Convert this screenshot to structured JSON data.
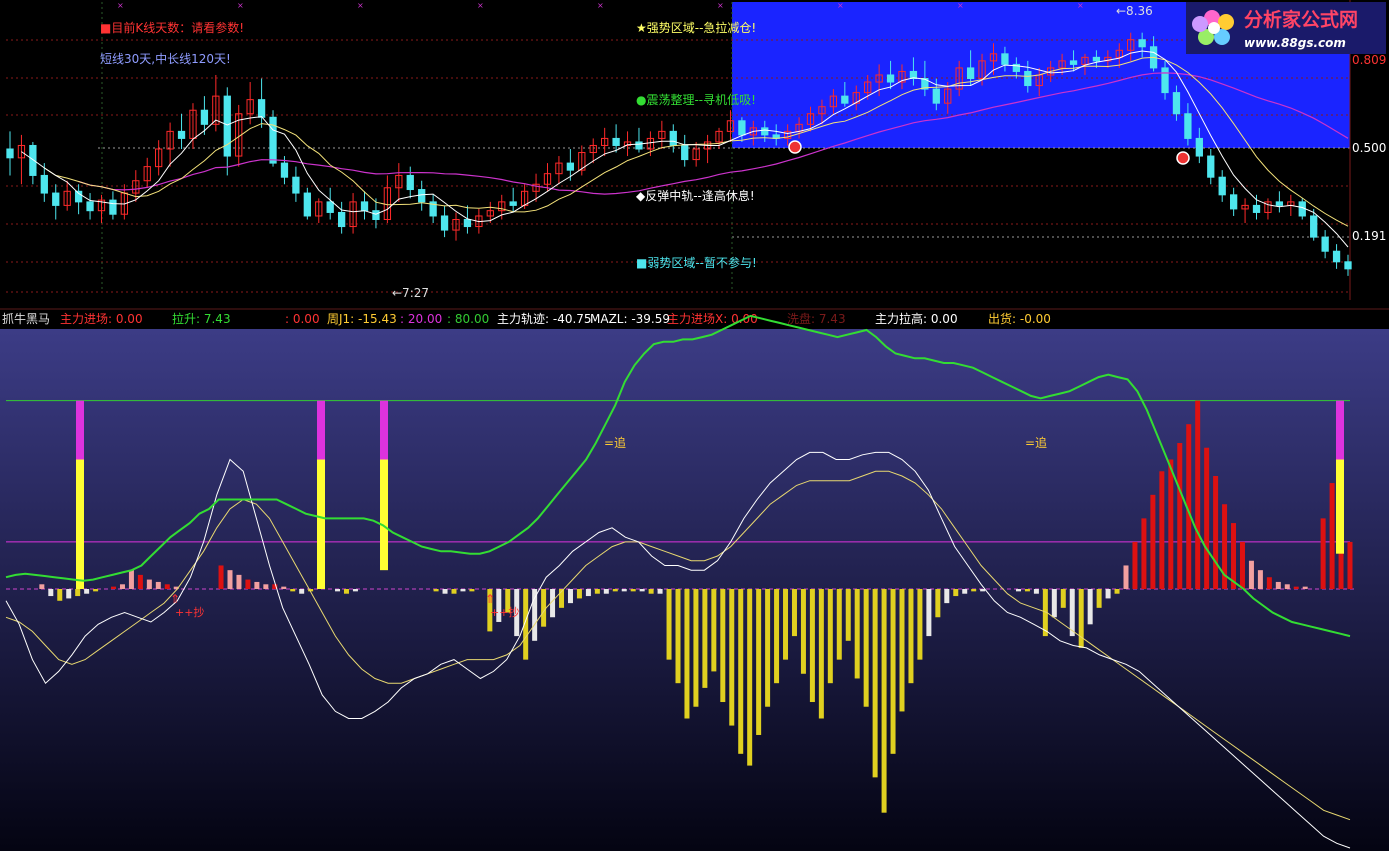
{
  "colors": {
    "bg": "#000000",
    "up": "#ff2a2a",
    "down": "#4ee6ee",
    "ma_short": "#ffffff",
    "ma_mid": "#f4e27a",
    "ma_long": "#cc33cc",
    "zone_blue": "#1a24ff",
    "grid_red": "#8a1a1a",
    "grid_gray": "#9a9a9a",
    "green_line": "#33dd33",
    "magenta": "#dd33dd",
    "yellow": "#ffff33",
    "red_bar": "#dd1111",
    "pink_bar": "#f2a0a0",
    "gold_bar": "#e0d020",
    "white_bar": "#e8e8e8",
    "header_label": "#ff3333",
    "header_value": "#ffcc33"
  },
  "logo": {
    "text": "分析家公式网",
    "url": "www.88gs.com"
  },
  "top_panel": {
    "annotations": {
      "k_days": "■目前K线天数：请看参数!",
      "periods": "短线30天,中长线120天!",
      "strong": "★强势区域--急拉减仓!",
      "shock": "●震荡整理--寻机低吸!",
      "rebound": "◆反弹中轨--逢高休息!",
      "weak": "■弱势区域--暂不参与!",
      "low_mark": "←7:27",
      "high_mark": "←8.36"
    },
    "levels": {
      "l809": "0.809",
      "l500": "0.500",
      "l191": "0.191"
    }
  },
  "header": {
    "name": "抓牛黑马",
    "items": [
      {
        "label": "主力进场:",
        "value": "0.00"
      },
      {
        "label": "拉升:",
        "value": "7.43"
      },
      {
        "label": "",
        "value": ": 0.00"
      },
      {
        "label": "周J1:",
        "value": "-15.43"
      },
      {
        "label": "",
        "value": ": 20.00"
      },
      {
        "label": "",
        "value": ": 80.00"
      },
      {
        "label": "主力轨迹:",
        "value": "-40.75"
      },
      {
        "label": "MAZL:",
        "value": "-39.59"
      },
      {
        "label": "主力进场X:",
        "value": "0.00"
      },
      {
        "label": "洗盘:",
        "value": "7.43"
      },
      {
        "label": "主力拉高:",
        "value": "0.00"
      },
      {
        "label": "出货:",
        "value": "-0.00"
      }
    ]
  },
  "bottom_panel": {
    "signals": {
      "chao1": "++抄",
      "chao2": "++抄",
      "zhui1": "=追",
      "zhui2": "=追"
    }
  },
  "chart_data": [
    {
      "type": "candlestick",
      "title": "",
      "ylim": [
        6.9,
        8.5
      ],
      "y_marks": [
        {
          "label": "0.809",
          "fraction": 0.809
        },
        {
          "label": "0.500",
          "fraction": 0.5
        },
        {
          "label": "0.191",
          "fraction": 0.191
        }
      ],
      "price_labels": {
        "low": 7.27,
        "high": 8.36
      },
      "candles": [
        [
          7.7,
          7.8,
          7.55,
          7.65
        ],
        [
          7.65,
          7.78,
          7.5,
          7.72
        ],
        [
          7.72,
          7.74,
          7.5,
          7.55
        ],
        [
          7.55,
          7.62,
          7.4,
          7.45
        ],
        [
          7.45,
          7.5,
          7.3,
          7.38
        ],
        [
          7.38,
          7.52,
          7.35,
          7.46
        ],
        [
          7.46,
          7.5,
          7.33,
          7.4
        ],
        [
          7.4,
          7.45,
          7.3,
          7.35
        ],
        [
          7.35,
          7.44,
          7.28,
          7.41
        ],
        [
          7.41,
          7.46,
          7.3,
          7.33
        ],
        [
          7.33,
          7.5,
          7.3,
          7.45
        ],
        [
          7.45,
          7.58,
          7.4,
          7.52
        ],
        [
          7.52,
          7.65,
          7.48,
          7.6
        ],
        [
          7.6,
          7.75,
          7.55,
          7.7
        ],
        [
          7.7,
          7.85,
          7.6,
          7.8
        ],
        [
          7.8,
          7.9,
          7.7,
          7.76
        ],
        [
          7.76,
          7.96,
          7.7,
          7.92
        ],
        [
          7.92,
          8.0,
          7.78,
          7.84
        ],
        [
          7.84,
          8.12,
          7.8,
          8.0
        ],
        [
          8.0,
          8.05,
          7.55,
          7.66
        ],
        [
          7.66,
          7.95,
          7.6,
          7.9
        ],
        [
          7.9,
          8.08,
          7.84,
          7.98
        ],
        [
          7.98,
          8.1,
          7.82,
          7.88
        ],
        [
          7.88,
          7.92,
          7.6,
          7.62
        ],
        [
          7.62,
          7.66,
          7.5,
          7.54
        ],
        [
          7.54,
          7.6,
          7.4,
          7.45
        ],
        [
          7.45,
          7.48,
          7.3,
          7.32
        ],
        [
          7.32,
          7.42,
          7.28,
          7.4
        ],
        [
          7.4,
          7.48,
          7.3,
          7.34
        ],
        [
          7.34,
          7.4,
          7.22,
          7.26
        ],
        [
          7.26,
          7.45,
          7.22,
          7.4
        ],
        [
          7.4,
          7.46,
          7.3,
          7.35
        ],
        [
          7.35,
          7.42,
          7.25,
          7.3
        ],
        [
          7.3,
          7.55,
          7.28,
          7.48
        ],
        [
          7.48,
          7.62,
          7.4,
          7.55
        ],
        [
          7.55,
          7.6,
          7.42,
          7.47
        ],
        [
          7.47,
          7.52,
          7.35,
          7.4
        ],
        [
          7.4,
          7.44,
          7.28,
          7.32
        ],
        [
          7.32,
          7.38,
          7.2,
          7.24
        ],
        [
          7.24,
          7.34,
          7.18,
          7.3
        ],
        [
          7.3,
          7.38,
          7.22,
          7.26
        ],
        [
          7.26,
          7.36,
          7.22,
          7.32
        ],
        [
          7.32,
          7.4,
          7.28,
          7.35
        ],
        [
          7.35,
          7.44,
          7.3,
          7.4
        ],
        [
          7.4,
          7.48,
          7.34,
          7.38
        ],
        [
          7.38,
          7.5,
          7.36,
          7.46
        ],
        [
          7.46,
          7.56,
          7.4,
          7.5
        ],
        [
          7.5,
          7.62,
          7.46,
          7.56
        ],
        [
          7.56,
          7.66,
          7.5,
          7.62
        ],
        [
          7.62,
          7.7,
          7.52,
          7.58
        ],
        [
          7.58,
          7.72,
          7.55,
          7.68
        ],
        [
          7.68,
          7.76,
          7.62,
          7.72
        ],
        [
          7.72,
          7.82,
          7.66,
          7.76
        ],
        [
          7.76,
          7.84,
          7.68,
          7.72
        ],
        [
          7.72,
          7.8,
          7.66,
          7.74
        ],
        [
          7.74,
          7.82,
          7.68,
          7.7
        ],
        [
          7.7,
          7.8,
          7.66,
          7.76
        ],
        [
          7.76,
          7.86,
          7.7,
          7.8
        ],
        [
          7.8,
          7.84,
          7.68,
          7.72
        ],
        [
          7.72,
          7.78,
          7.6,
          7.64
        ],
        [
          7.64,
          7.74,
          7.6,
          7.7
        ],
        [
          7.7,
          7.78,
          7.62,
          7.74
        ],
        [
          7.74,
          7.82,
          7.7,
          7.8
        ],
        [
          7.8,
          7.92,
          7.74,
          7.86
        ],
        [
          7.86,
          7.88,
          7.74,
          7.78
        ],
        [
          7.78,
          7.86,
          7.72,
          7.82
        ],
        [
          7.82,
          7.86,
          7.74,
          7.78
        ],
        [
          7.78,
          7.84,
          7.72,
          7.76
        ],
        [
          7.76,
          7.84,
          7.72,
          7.8
        ],
        [
          7.8,
          7.88,
          7.76,
          7.84
        ],
        [
          7.84,
          7.94,
          7.8,
          7.9
        ],
        [
          7.9,
          7.98,
          7.84,
          7.94
        ],
        [
          7.94,
          8.04,
          7.9,
          8.0
        ],
        [
          8.0,
          8.08,
          7.94,
          7.96
        ],
        [
          7.96,
          8.06,
          7.92,
          8.02
        ],
        [
          8.02,
          8.12,
          7.98,
          8.08
        ],
        [
          8.08,
          8.18,
          8.0,
          8.12
        ],
        [
          8.12,
          8.2,
          8.04,
          8.08
        ],
        [
          8.08,
          8.18,
          8.04,
          8.14
        ],
        [
          8.14,
          8.22,
          8.06,
          8.1
        ],
        [
          8.1,
          8.2,
          8.0,
          8.04
        ],
        [
          8.04,
          8.1,
          7.92,
          7.96
        ],
        [
          7.96,
          8.08,
          7.9,
          8.04
        ],
        [
          8.04,
          8.2,
          8.0,
          8.16
        ],
        [
          8.16,
          8.26,
          8.06,
          8.1
        ],
        [
          8.1,
          8.24,
          8.06,
          8.2
        ],
        [
          8.2,
          8.3,
          8.12,
          8.24
        ],
        [
          8.24,
          8.28,
          8.14,
          8.18
        ],
        [
          8.18,
          8.22,
          8.1,
          8.14
        ],
        [
          8.14,
          8.2,
          8.02,
          8.06
        ],
        [
          8.06,
          8.16,
          8.0,
          8.12
        ],
        [
          8.12,
          8.2,
          8.08,
          8.16
        ],
        [
          8.16,
          8.24,
          8.12,
          8.2
        ],
        [
          8.2,
          8.26,
          8.14,
          8.18
        ],
        [
          8.18,
          8.24,
          8.12,
          8.22
        ],
        [
          8.22,
          8.26,
          8.16,
          8.2
        ],
        [
          8.2,
          8.26,
          8.16,
          8.22
        ],
        [
          8.22,
          8.3,
          8.16,
          8.26
        ],
        [
          8.26,
          8.36,
          8.2,
          8.32
        ],
        [
          8.32,
          8.36,
          8.22,
          8.28
        ],
        [
          8.28,
          8.34,
          8.14,
          8.16
        ],
        [
          8.16,
          8.2,
          7.98,
          8.02
        ],
        [
          8.02,
          8.06,
          7.86,
          7.9
        ],
        [
          7.9,
          7.96,
          7.72,
          7.76
        ],
        [
          7.76,
          7.82,
          7.62,
          7.66
        ],
        [
          7.66,
          7.7,
          7.5,
          7.54
        ],
        [
          7.54,
          7.58,
          7.4,
          7.44
        ],
        [
          7.44,
          7.48,
          7.32,
          7.36
        ],
        [
          7.36,
          7.42,
          7.28,
          7.38
        ],
        [
          7.38,
          7.44,
          7.3,
          7.34
        ],
        [
          7.34,
          7.42,
          7.3,
          7.4
        ],
        [
          7.4,
          7.46,
          7.34,
          7.38
        ],
        [
          7.38,
          7.44,
          7.32,
          7.4
        ],
        [
          7.4,
          7.42,
          7.3,
          7.32
        ],
        [
          7.32,
          7.36,
          7.18,
          7.2
        ],
        [
          7.2,
          7.24,
          7.08,
          7.12
        ],
        [
          7.12,
          7.16,
          7.02,
          7.06
        ],
        [
          7.06,
          7.1,
          6.98,
          7.02
        ]
      ]
    },
    {
      "type": "indicator",
      "title": "抓牛黑马",
      "ylim": [
        -110,
        110
      ],
      "reference_lines": [
        80,
        20,
        0
      ],
      "main_track": [
        5,
        6,
        6.5,
        6,
        5.5,
        5,
        4.5,
        4,
        3.5,
        4,
        5,
        6,
        7,
        8,
        10,
        14,
        18,
        22,
        25,
        28,
        32,
        34,
        38,
        38,
        38,
        38,
        38,
        38,
        38,
        36,
        34,
        32,
        31,
        30,
        30,
        30,
        30,
        30,
        29,
        27,
        24,
        22,
        20,
        18,
        17,
        16,
        16,
        15.5,
        15,
        15,
        16,
        18,
        20,
        23,
        26,
        30,
        35,
        40,
        45,
        50,
        55,
        62,
        70,
        78,
        88,
        95,
        100,
        104,
        105,
        105,
        106,
        106,
        107,
        108,
        110,
        112,
        114,
        116,
        115,
        114,
        113,
        112,
        111,
        110,
        109,
        108,
        107,
        108,
        109,
        110,
        107,
        103,
        100,
        99,
        98,
        98,
        97,
        96,
        96,
        95,
        94,
        92,
        90,
        88,
        86,
        84,
        82,
        81,
        82,
        83,
        84,
        86,
        88,
        90,
        91,
        90,
        89,
        84,
        76,
        66,
        56,
        46,
        36,
        26,
        18,
        12,
        6,
        3,
        0,
        -4,
        -7,
        -10,
        -12,
        -14,
        -15,
        -16,
        -17,
        -18,
        -19,
        -20
      ],
      "fast_line": [
        -5,
        -15,
        -30,
        -40,
        -35,
        -28,
        -20,
        -15,
        -12,
        -10,
        -12,
        -14,
        -10,
        -5,
        5,
        20,
        40,
        55,
        50,
        30,
        10,
        -8,
        -20,
        -32,
        -45,
        -52,
        -55,
        -55,
        -52,
        -48,
        -42,
        -38,
        -36,
        -32,
        -30,
        -34,
        -38,
        -35,
        -30,
        -20,
        -5,
        5,
        10,
        16,
        20,
        24,
        26,
        22,
        20,
        14,
        10,
        10,
        8,
        8,
        12,
        20,
        30,
        38,
        45,
        50,
        55,
        58,
        58,
        55,
        55,
        57,
        58,
        58,
        55,
        50,
        42,
        30,
        18,
        10,
        2,
        -5,
        -10,
        -12,
        -15,
        -18,
        -22,
        -24,
        -25,
        -28,
        -30,
        -32,
        -35,
        -40,
        -45,
        -50,
        -55,
        -60,
        -65,
        -70,
        -75,
        -80,
        -85,
        -90,
        -95,
        -100,
        -105,
        -108,
        -110
      ],
      "slow_line": [
        -12,
        -14,
        -18,
        -24,
        -30,
        -32,
        -30,
        -26,
        -22,
        -18,
        -14,
        -10,
        -6,
        0,
        8,
        16,
        26,
        34,
        38,
        36,
        30,
        20,
        10,
        0,
        -10,
        -20,
        -28,
        -34,
        -38,
        -40,
        -40,
        -38,
        -36,
        -34,
        -32,
        -30,
        -30,
        -30,
        -28,
        -24,
        -16,
        -8,
        -2,
        4,
        10,
        14,
        18,
        20,
        20,
        18,
        16,
        14,
        12,
        12,
        14,
        18,
        24,
        30,
        36,
        40,
        44,
        46,
        46,
        46,
        46,
        48,
        50,
        50,
        48,
        45,
        40,
        34,
        26,
        18,
        10,
        4,
        -2,
        -6,
        -8,
        -10,
        -14,
        -18,
        -22,
        -26,
        -30,
        -34,
        -38,
        -42,
        -46,
        -50,
        -54,
        -58,
        -62,
        -66,
        -70,
        -74,
        -78,
        -82,
        -86,
        -90,
        -94,
        -96,
        -98
      ],
      "bars": [
        0,
        0,
        0,
        0,
        2,
        -3,
        -5,
        -4,
        -3,
        -2,
        -1,
        0,
        1,
        2,
        8,
        6,
        4,
        3,
        2,
        1,
        0,
        0,
        0,
        0,
        10,
        8,
        6,
        4,
        3,
        2,
        2,
        1,
        -1,
        -2,
        -1,
        0,
        0,
        -1,
        -2,
        -1,
        0,
        0,
        0,
        0,
        0,
        0,
        0,
        0,
        -1,
        -2,
        -2,
        -1,
        -1,
        0,
        -18,
        -14,
        -10,
        -20,
        -30,
        -22,
        -16,
        -12,
        -8,
        -6,
        -4,
        -3,
        -2,
        -2,
        -1,
        -1,
        -1,
        -1,
        -2,
        -2,
        -30,
        -40,
        -55,
        -50,
        -42,
        -35,
        -48,
        -58,
        -70,
        -75,
        -62,
        -50,
        -40,
        -30,
        -20,
        -36,
        -48,
        -55,
        -40,
        -30,
        -22,
        -38,
        -50,
        -80,
        -95,
        -70,
        -52,
        -40,
        -30,
        -20,
        -12,
        -6,
        -3,
        -2,
        -1,
        -1,
        0,
        0,
        0,
        -1,
        -1,
        -2,
        -20,
        -12,
        -8,
        -20,
        -25,
        -15,
        -8,
        -4,
        -2,
        10,
        20,
        30,
        40,
        50,
        55,
        62,
        70,
        80,
        60,
        48,
        36,
        28,
        20,
        12,
        8,
        5,
        3,
        2,
        1,
        1,
        0,
        30,
        45,
        35,
        20
      ],
      "spikes": [
        {
          "index": 10,
          "low": 0,
          "high": 80
        },
        {
          "index": 60,
          "low": 0,
          "high": 80
        },
        {
          "index": 72,
          "low": 8,
          "high": 80
        },
        {
          "index": 255,
          "low": 15,
          "high": 80
        }
      ]
    }
  ]
}
